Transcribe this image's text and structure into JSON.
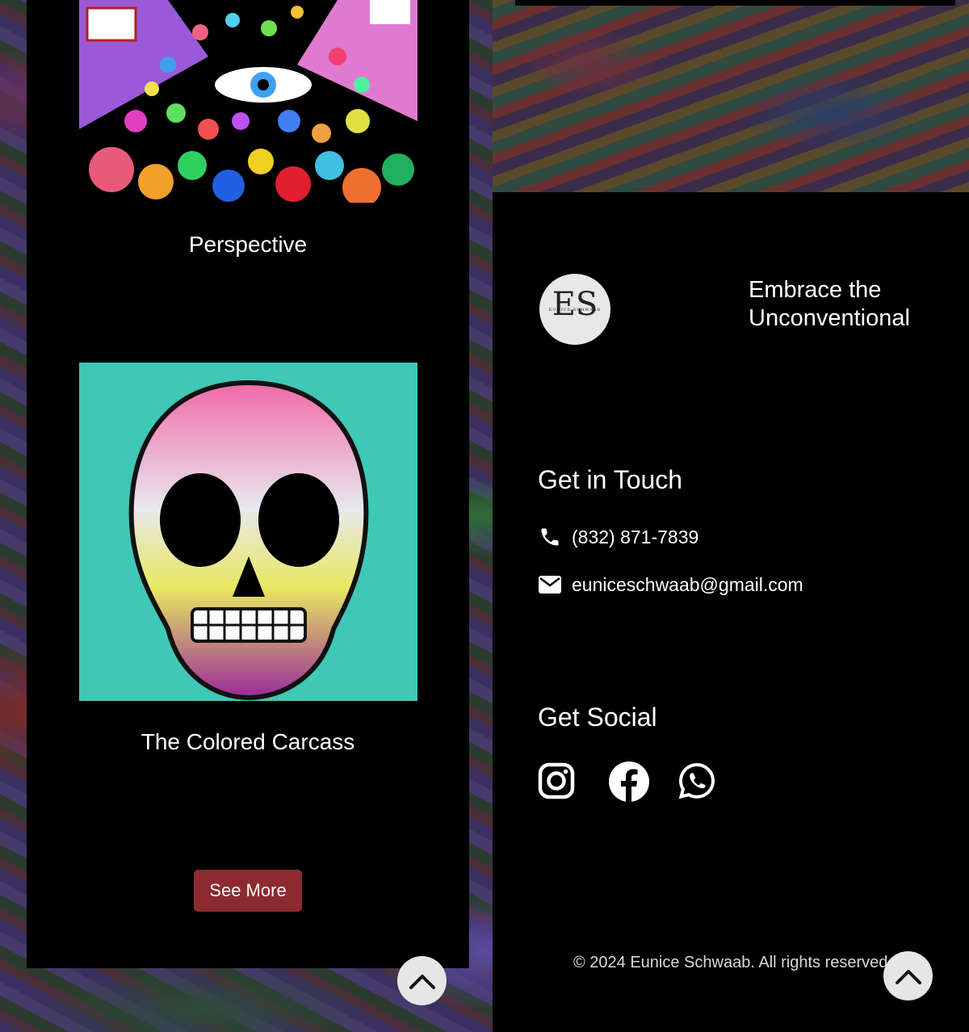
{
  "gallery": {
    "items": [
      {
        "title": "Perspective"
      },
      {
        "title": "The Colored Carcass"
      }
    ],
    "see_more_label": "See More"
  },
  "footer": {
    "logo_monogram": "ES",
    "logo_name": "EUNICE SCHWAAB",
    "tagline": "Embrace the Unconventional",
    "contact_heading": "Get in Touch",
    "phone": "(832) 871-7839",
    "email": "euniceschwaab@gmail.com",
    "social_heading": "Get Social",
    "social_icons": [
      "instagram-icon",
      "facebook-icon",
      "whatsapp-icon"
    ],
    "copyright": "© 2024 Eunice Schwaab. All rights reserved."
  },
  "colors": {
    "panel": "#000000",
    "button": "#8d2a2f",
    "back_to_top": "#e6e6e6",
    "artwork_skull_bg": "#3fc8b6"
  }
}
